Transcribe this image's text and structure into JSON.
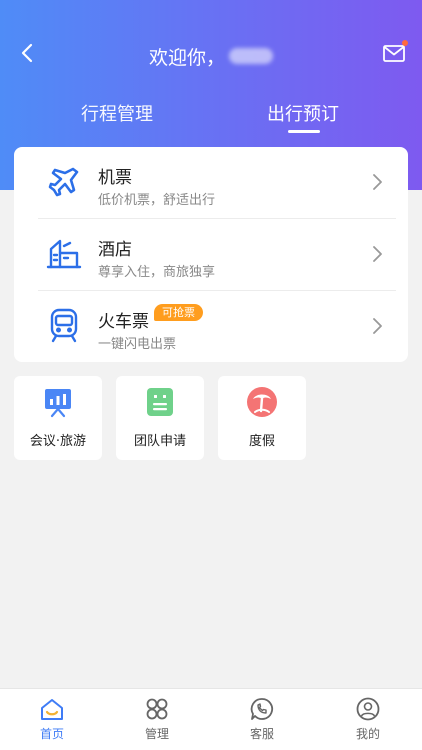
{
  "header": {
    "greeting": "欢迎你，",
    "back_icon": "back-arrow-icon",
    "mail_icon": "mail-icon"
  },
  "tabs": [
    {
      "label": "行程管理",
      "active": false
    },
    {
      "label": "出行预订",
      "active": true
    }
  ],
  "booking_items": [
    {
      "title": "机票",
      "subtitle": "低价机票，舒适出行",
      "icon": "airplane-icon"
    },
    {
      "title": "酒店",
      "subtitle": "尊享入住，商旅独享",
      "icon": "hotel-icon"
    },
    {
      "title": "火车票",
      "subtitle": "一键闪电出票",
      "icon": "train-icon",
      "badge": "可抢票"
    }
  ],
  "tiles": [
    {
      "label": "会议·旅游",
      "icon": "presentation-board-icon"
    },
    {
      "label": "团队申请",
      "icon": "team-form-icon"
    },
    {
      "label": "度假",
      "icon": "vacation-island-icon"
    }
  ],
  "bottom_nav": [
    {
      "label": "首页",
      "icon": "home-icon",
      "active": true
    },
    {
      "label": "管理",
      "icon": "grid-manage-icon",
      "active": false
    },
    {
      "label": "客服",
      "icon": "customer-service-icon",
      "active": false
    },
    {
      "label": "我的",
      "icon": "profile-icon",
      "active": false
    }
  ],
  "colors": {
    "accent": "#3f7cf6",
    "header_start": "#4f8cf7",
    "header_end": "#7e5af0",
    "badge": "#ff9d1e"
  }
}
